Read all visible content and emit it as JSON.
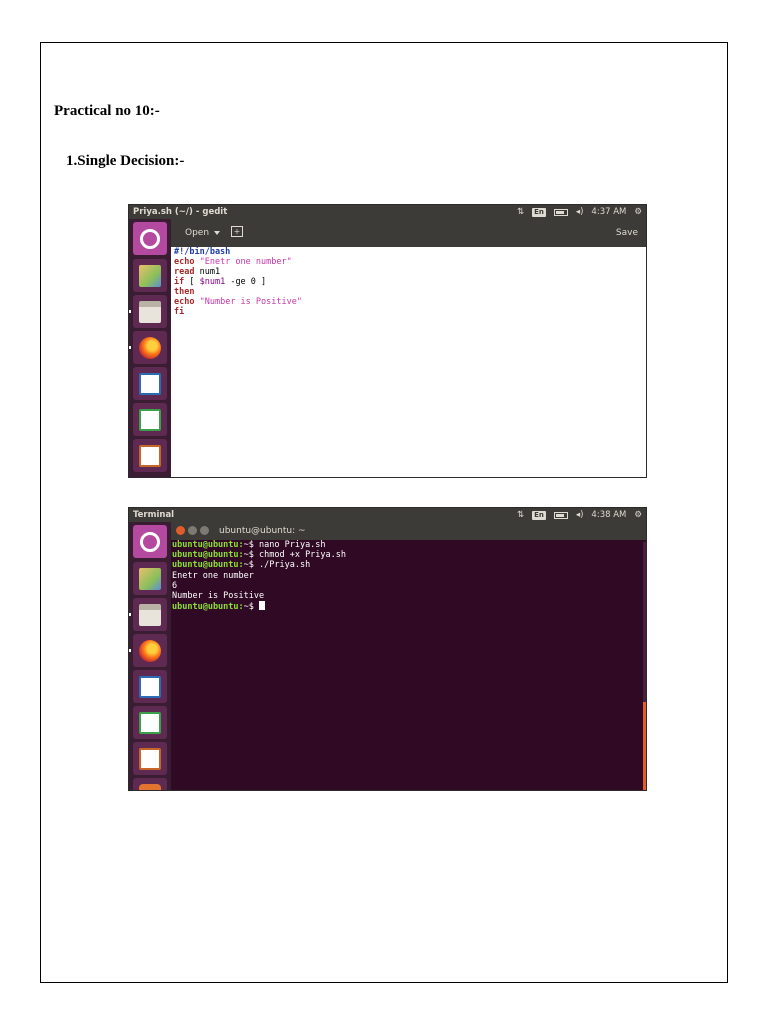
{
  "document": {
    "heading": "Practical no 10:-",
    "subheading": "1.Single Decision:-"
  },
  "gedit": {
    "window_title": "Priya.sh (~/) - gedit",
    "keyboard_layout": "En",
    "time": "4:37 AM",
    "open_label": "Open",
    "new_tab_label": "+",
    "save_label": "Save",
    "code_lines": [
      [
        {
          "t": "#!/bin/bash",
          "c": "kw-shebang"
        }
      ],
      [
        {
          "t": "echo",
          "c": "kw"
        },
        {
          "t": " ",
          "c": ""
        },
        {
          "t": "\"Enetr one number\"",
          "c": "str"
        }
      ],
      [
        {
          "t": "read",
          "c": "kw"
        },
        {
          "t": " num1",
          "c": ""
        }
      ],
      [
        {
          "t": "if",
          "c": "kw"
        },
        {
          "t": " [ ",
          "c": ""
        },
        {
          "t": "$num1",
          "c": "var"
        },
        {
          "t": " -ge 0 ]",
          "c": ""
        }
      ],
      [
        {
          "t": "then",
          "c": "kw"
        }
      ],
      [
        {
          "t": "echo",
          "c": "kw"
        },
        {
          "t": " ",
          "c": ""
        },
        {
          "t": "\"Number is Positive\"",
          "c": "str"
        }
      ],
      [
        {
          "t": "fi",
          "c": "kw"
        }
      ]
    ]
  },
  "terminal": {
    "app_name": "Terminal",
    "keyboard_layout": "En",
    "time": "4:38 AM",
    "window_title": "ubuntu@ubuntu: ~",
    "lines": [
      {
        "prompt": "ubuntu@ubuntu:",
        "text": "~$ nano Priya.sh"
      },
      {
        "prompt": "ubuntu@ubuntu:",
        "text": "~$ chmod +x Priya.sh"
      },
      {
        "prompt": "ubuntu@ubuntu:",
        "text": "~$ ./Priya.sh"
      },
      {
        "prompt": "",
        "text": "Enetr one number"
      },
      {
        "prompt": "",
        "text": "6"
      },
      {
        "prompt": "",
        "text": "Number is Positive"
      },
      {
        "prompt": "ubuntu@ubuntu:",
        "text": "~$ ",
        "cursor": true
      }
    ]
  },
  "launcher": [
    "ubuntu-logo-icon",
    "software-center-icon",
    "files-icon",
    "firefox-icon",
    "writer-icon",
    "calc-icon",
    "impress-icon"
  ]
}
